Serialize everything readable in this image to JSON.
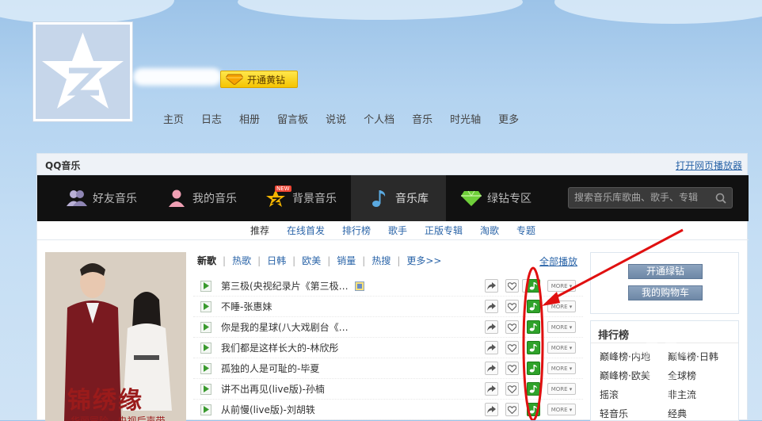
{
  "header": {
    "badge_label": "开通黄钻"
  },
  "nav": {
    "items": [
      "主页",
      "日志",
      "相册",
      "留言板",
      "说说",
      "个人档",
      "音乐",
      "时光轴",
      "更多"
    ]
  },
  "panel": {
    "title": "QQ音乐",
    "open_player_link": "打开网页播放器"
  },
  "music_tabs": [
    {
      "label": "好友音乐",
      "icon": "friends-icon"
    },
    {
      "label": "我的音乐",
      "icon": "user-icon"
    },
    {
      "label": "背景音乐",
      "icon": "star-new-icon",
      "badge": "NEW"
    },
    {
      "label": "音乐库",
      "icon": "music-note-icon",
      "active": true
    },
    {
      "label": "绿钻专区",
      "icon": "green-diamond-icon"
    }
  ],
  "search": {
    "placeholder": "搜索音乐库歌曲、歌手、专辑"
  },
  "subnav": {
    "items": [
      "推荐",
      "在线首发",
      "排行榜",
      "歌手",
      "正版专辑",
      "淘歌",
      "专题"
    ],
    "current": "推荐"
  },
  "poster": {
    "title": "锦绣缘",
    "subtitle": "华丽冒险 · 央视后声带"
  },
  "categories": {
    "items": [
      "新歌",
      "热歌",
      "日韩",
      "欧美",
      "销量",
      "热搜",
      "更多>>"
    ],
    "current": "新歌",
    "play_all": "全部播放"
  },
  "songs": [
    {
      "title": "第三极(央视纪录片《第三极…",
      "has_tag": true
    },
    {
      "title": "不睡-张惠妹",
      "has_tag": false
    },
    {
      "title": "你是我的星球(八大戏剧台《…",
      "has_tag": false
    },
    {
      "title": "我们都是这样长大的-林欣彤",
      "has_tag": false
    },
    {
      "title": "孤独的人是可耻的-毕夏",
      "has_tag": false
    },
    {
      "title": "讲不出再见(live版)-孙楠",
      "has_tag": false
    },
    {
      "title": "从前慢(live版)-刘胡轶",
      "has_tag": false
    }
  ],
  "more_label": "MORE",
  "right_panel": {
    "btn_green": "开通绿钻",
    "btn_cart": "我的购物车",
    "rank_title": "排行榜",
    "ranks": [
      "巅峰榜·内地",
      "巅峰榜·日韩",
      "巅峰榜·欧美",
      "全球榜",
      "摇滚",
      "非主流",
      "轻音乐",
      "经典"
    ]
  },
  "colors": {
    "accent_link": "#2a64a8",
    "music_bar": "#111111",
    "green_button": "#2fa22a",
    "annotation_red": "#e01010"
  }
}
